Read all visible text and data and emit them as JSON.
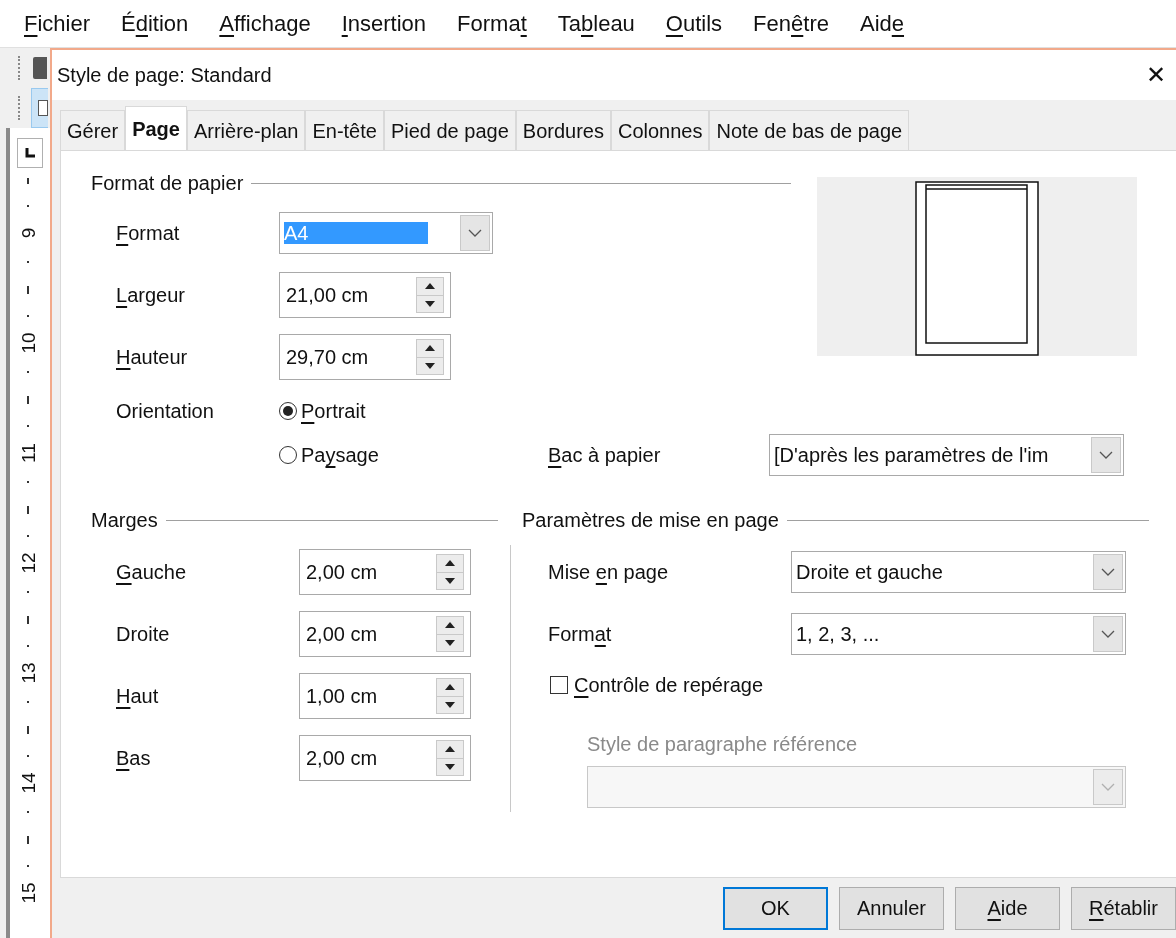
{
  "menu": [
    {
      "key": "F",
      "post": "ichier"
    },
    {
      "pre": "É",
      "key": "d",
      "post": "ition"
    },
    {
      "key": "A",
      "post": "ffichage"
    },
    {
      "key": "I",
      "post": "nsertion"
    },
    {
      "pre": "Forma",
      "key": "t"
    },
    {
      "pre": "Ta",
      "key": "b",
      "post": "leau"
    },
    {
      "key": "O",
      "post": "utils"
    },
    {
      "pre": "Fen",
      "key": "ê",
      "post": "tre"
    },
    {
      "pre": "Aid",
      "key": "e"
    }
  ],
  "ruler": [
    "9",
    "10",
    "11",
    "12",
    "13",
    "14",
    "15"
  ],
  "dialog": {
    "title": "Style de page: Standard",
    "close": "✕",
    "tabs": [
      {
        "label": "Gérer",
        "selected": false
      },
      {
        "label": "Page",
        "selected": true
      },
      {
        "label": "Arrière-plan",
        "selected": false
      },
      {
        "label": "En-tête",
        "selected": false
      },
      {
        "label": "Pied de page",
        "selected": false
      },
      {
        "label": "Bordures",
        "selected": false
      },
      {
        "label": "Colonnes",
        "selected": false
      },
      {
        "label": "Note de bas de page",
        "selected": false
      }
    ],
    "paper": {
      "heading": "Format de papier",
      "format": {
        "label": {
          "key": "F",
          "post": "ormat"
        },
        "value": "A4",
        "focused": true
      },
      "width": {
        "label": {
          "key": "L",
          "post": "argeur"
        },
        "value": "21,00 cm"
      },
      "height": {
        "label": {
          "key": "H",
          "post": "auteur"
        },
        "value": "29,70 cm"
      },
      "orientation": {
        "label": {
          "text": "Orientation"
        },
        "options": [
          {
            "label": {
              "key": "P",
              "post": "ortrait"
            },
            "selected": true
          },
          {
            "label": {
              "pre": "Pa",
              "key": "y",
              "post": "sage"
            },
            "selected": false
          }
        ]
      },
      "tray": {
        "label": {
          "key": "B",
          "post": "ac à papier"
        },
        "value": "[D'après les paramètres de l'im"
      }
    },
    "margins": {
      "heading": "Marges",
      "rows": [
        {
          "label": {
            "key": "G",
            "post": "auche"
          },
          "value": "2,00 cm"
        },
        {
          "label": {
            "text": "Droite"
          },
          "value": "2,00 cm"
        },
        {
          "label": {
            "key": "H",
            "post": "aut"
          },
          "value": "1,00 cm"
        },
        {
          "label": {
            "key": "B",
            "post": "as"
          },
          "value": "2,00 cm"
        }
      ]
    },
    "layout": {
      "heading": "Paramètres de mise en page",
      "page_layout": {
        "label": {
          "pre": "Mise ",
          "key": "e",
          "post": "n page"
        },
        "value": "Droite et gauche"
      },
      "numbering": {
        "label": {
          "pre": "Form",
          "key": "a",
          "post": "t"
        },
        "value": "1, 2, 3, ..."
      },
      "register": {
        "label": {
          "key": "C",
          "post": "ontrôle de repérage"
        },
        "checked": false
      },
      "reference": {
        "label": {
          "text": "Style de paragraphe référence"
        },
        "disabled": true
      }
    },
    "buttons": [
      {
        "label": {
          "text": "OK"
        },
        "default": true
      },
      {
        "label": {
          "text": "Annuler"
        },
        "default": false
      },
      {
        "label": {
          "key": "A",
          "post": "ide"
        },
        "default": false
      },
      {
        "label": {
          "key": "R",
          "post": "établir"
        },
        "default": false
      }
    ]
  }
}
